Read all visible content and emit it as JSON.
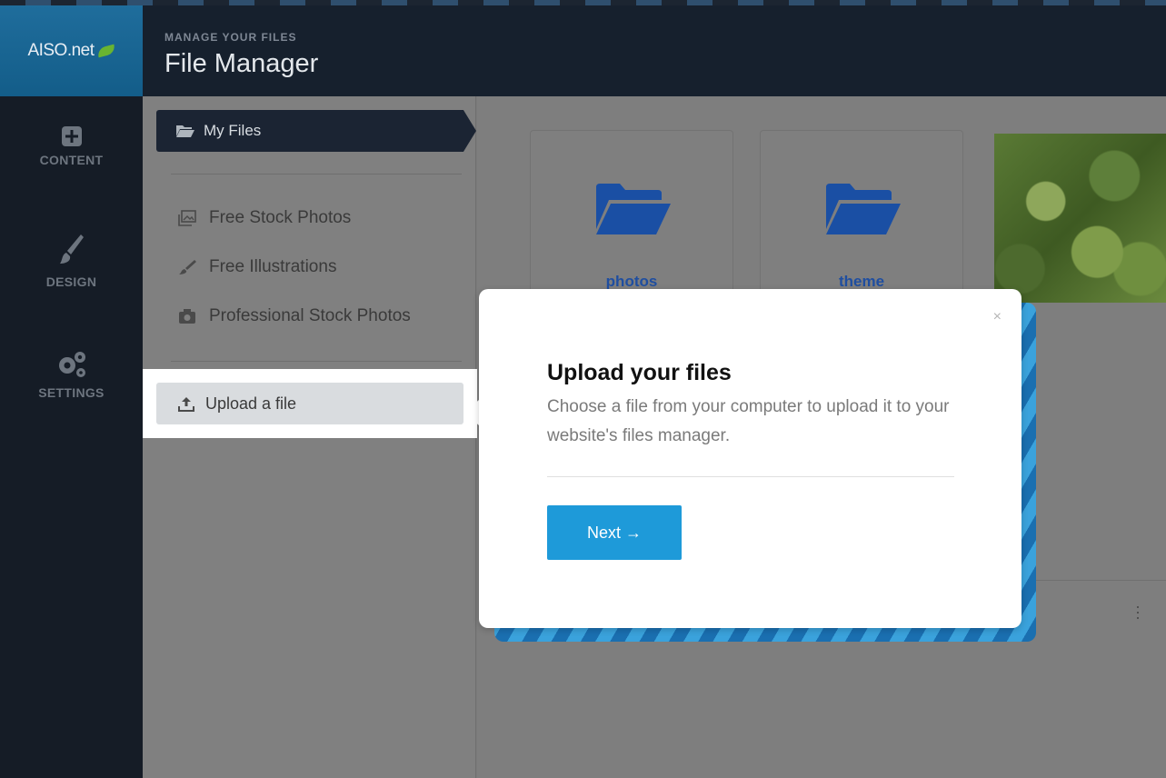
{
  "brand": {
    "logo_text": "AISO.net",
    "accent": "#1e9ad9"
  },
  "rail": {
    "items": [
      {
        "label": "CONTENT",
        "icon": "plus-square-icon"
      },
      {
        "label": "DESIGN",
        "icon": "paintbrush-icon"
      },
      {
        "label": "SETTINGS",
        "icon": "gears-icon"
      }
    ]
  },
  "header": {
    "subtitle": "MANAGE YOUR FILES",
    "title": "File Manager"
  },
  "sidebar": {
    "my_files": "My Files",
    "links": [
      {
        "label": "Free Stock Photos",
        "icon": "images-icon"
      },
      {
        "label": "Free Illustrations",
        "icon": "brush-icon"
      },
      {
        "label": "Professional Stock Photos",
        "icon": "camera-icon"
      }
    ],
    "upload": "Upload a file"
  },
  "main": {
    "folders": [
      {
        "name": "photos"
      },
      {
        "name": "theme"
      }
    ]
  },
  "popup": {
    "close": "×",
    "title": "Upload your files",
    "description": "Choose a file from your computer to upload it to your website's files manager.",
    "next": "Next →"
  }
}
